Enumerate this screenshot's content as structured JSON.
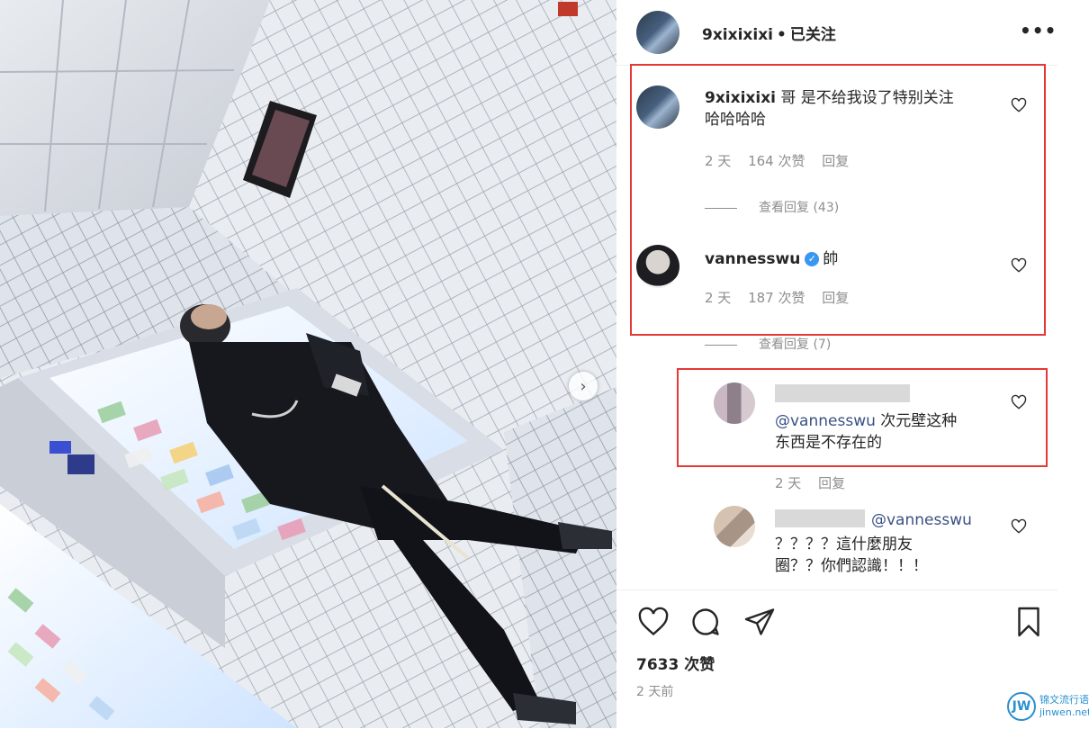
{
  "post": {
    "author": "9xixixixi",
    "follow_status": "已关注",
    "separator": "•",
    "more_label": "•••",
    "likes": "7633 次赞",
    "time": "2 天前"
  },
  "comments": [
    {
      "user": "9xixixixi",
      "text_line1": "哥 是不给我设了特别关注",
      "text_line2": "哈哈哈哈",
      "age": "2 天",
      "likes": "164 次赞",
      "reply": "回复",
      "view_replies": "查看回复 (43)"
    },
    {
      "user": "vannesswu",
      "verified_mark": "✓",
      "text": "帥",
      "age": "2 天",
      "likes": "187 次赞",
      "reply": "回复",
      "view_replies": "查看回复 (7)"
    },
    {
      "mention": "@vannesswu",
      "text_line1": " 次元壁这种",
      "text_line2": "东西是不存在的",
      "age": "2 天",
      "reply": "回复"
    },
    {
      "mention": "@vannesswu",
      "text_line1": "？？？？這什麼朋友",
      "text_line2": "圈？？你們認識！！！"
    }
  ],
  "watermark": {
    "mark": "JW",
    "line1": "锦文流行语",
    "line2": "jinwen.net"
  },
  "colors": {
    "highlight_box": "#e53935",
    "mention": "#385185",
    "muted": "#8e8e8e",
    "verified": "#3897f0"
  },
  "icons": [
    "heart-icon",
    "comment-icon",
    "share-icon",
    "bookmark-icon",
    "chevron-right-icon",
    "more-icon"
  ]
}
